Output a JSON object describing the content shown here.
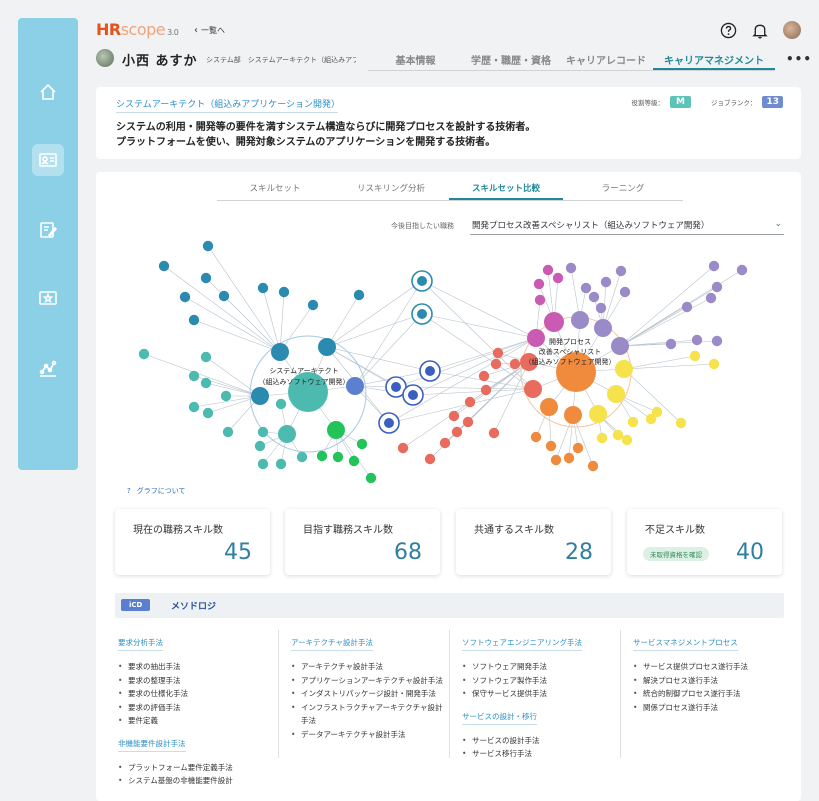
{
  "header": {
    "logo_hr": "HR",
    "logo_scope": "scope",
    "logo_version": "3.0",
    "back_link": "一覧へ",
    "icons": [
      "help-icon",
      "bell-icon",
      "avatar"
    ]
  },
  "user": {
    "name": "小西 あすか",
    "dept": "システム部　システムアーキテクト（組込みアプリー"
  },
  "top_tabs": [
    {
      "label": "基本情報",
      "active": false
    },
    {
      "label": "学歴・職歴・資格",
      "active": false
    },
    {
      "label": "キャリアレコード",
      "active": false
    },
    {
      "label": "キャリアマネジメント",
      "active": true
    }
  ],
  "more_label": "•••",
  "role": {
    "title": "システムアーキテクト（組込みアプリケーション開発）",
    "desc_line1": "システムの利用・開発等の要件を満すシステム構造ならびに開発プロセスを設計する技術者。",
    "desc_line2": "プラットフォームを使い、開発対象システムのアプリケーションを開発する技術者。",
    "grade_label": "役割等級：",
    "grade_value": "M",
    "rank_label": "ジョブランク：",
    "rank_value": "13"
  },
  "sub_tabs": [
    {
      "label": "スキルセット",
      "active": false
    },
    {
      "label": "リスキリング分析",
      "active": false
    },
    {
      "label": "スキルセット比較",
      "active": true
    },
    {
      "label": "ラーニング",
      "active": false
    }
  ],
  "target": {
    "label": "今後目指したい職務",
    "value": "開発プロセス改善スペシャリスト（組込みソフトウェア開発）"
  },
  "graph": {
    "current_label_1": "システムアーキテクト",
    "current_label_2": "（組込みソフトウェア開発）",
    "target_label_1": "開発プロセス",
    "target_label_2": "改善スペシャリスト",
    "target_label_3": "（組込みソフトウェア開発）",
    "help": "グラフについて",
    "colors": {
      "teal": "#4dbab0",
      "blue": "#2b8ab0",
      "green": "#22c45a",
      "red": "#e86b5e",
      "orange": "#f08a3c",
      "yellow": "#f6e24a",
      "purple": "#9a8ac8",
      "magenta": "#c95bb3"
    }
  },
  "stats": [
    {
      "label": "現在の職務スキル数",
      "value": "45"
    },
    {
      "label": "目指す職務スキル数",
      "value": "68"
    },
    {
      "label": "共通するスキル数",
      "value": "28"
    },
    {
      "label": "不足スキル数",
      "value": "40",
      "chip": "未取得資格を確認"
    }
  ],
  "methodology": {
    "tag": "iCD",
    "title": "メソドロジ",
    "columns": [
      {
        "groups": [
          {
            "cat": "要求分析手法",
            "items": [
              "要求の抽出手法",
              "要求の整理手法",
              "要求の仕様化手法",
              "要求の評価手法",
              "要件定義"
            ]
          },
          {
            "cat": "非機能要件設計手法",
            "items": [
              "プラットフォーム要件定義手法",
              "システム基盤の非機能要件設計"
            ]
          }
        ]
      },
      {
        "groups": [
          {
            "cat": "アーキテクチャ設計手法",
            "items": [
              "アーキテクチャ設計手法",
              "アプリケーションアーキテクチャ設計手法",
              "インダストリパッケージ設計・開発手法",
              "インフラストラクチャアーキテクチャ設計手法",
              "データアーキテクチャ設計手法"
            ]
          }
        ]
      },
      {
        "groups": [
          {
            "cat": "ソフトウェアエンジニアリング手法",
            "items": [
              "ソフトウェア開発手法",
              "ソフトウェア製作手法",
              "保守サービス提供手法"
            ]
          },
          {
            "cat": "サービスの設計・移行",
            "items": [
              "サービスの設計手法",
              "サービス移行手法"
            ]
          }
        ]
      },
      {
        "groups": [
          {
            "cat": "サービスマネジメントプロセス",
            "items": [
              "サービス提供プロセス遂行手法",
              "解決プロセス遂行手法",
              "統合的制御プロセス遂行手法",
              "関係プロセス遂行手法"
            ]
          }
        ]
      }
    ]
  }
}
